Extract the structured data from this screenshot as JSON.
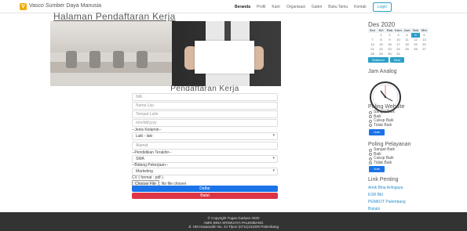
{
  "header": {
    "brand": "Vasco Sumber Daya Manusia",
    "nav": [
      "Beranda",
      "Profil",
      "Karir",
      "Organisasi",
      "Galeri",
      "Buku Tamu",
      "Kontak"
    ],
    "login_label": "Login"
  },
  "page": {
    "title": "Halaman Pendaftaran Kerja"
  },
  "form": {
    "title": "Pendaftaran Kerja",
    "nik_placeholder": "NIK",
    "nama_placeholder": "Nama Lkp",
    "tempat_placeholder": "Tempat Lahir",
    "tanggal_placeholder": "mm/dd/yyyy",
    "jenis_kelamin_label": "--Jenis Kelamin--",
    "jenis_kelamin_value": "Laki - laki",
    "alamat_placeholder": "Alamat",
    "pendidikan_label": "--Pendidikan Terakhir--",
    "pendidikan_value": "SMA",
    "bidang_label": "--Bidang Pekerjaan--",
    "bidang_value": "Marketing",
    "cv_label": "CV ( format : pdf )",
    "file_button": "Choose File",
    "file_status": "No file chosen",
    "submit_label": "Daftar",
    "reset_label": "Batal"
  },
  "calendar": {
    "title": "Des 2020",
    "days": [
      "Sen",
      "Sel",
      "Rab",
      "Kam",
      "Jum",
      "Sab",
      "Min"
    ],
    "weeks": [
      [
        "",
        "1",
        "2",
        "3",
        "4",
        "5",
        "6"
      ],
      [
        "7",
        "8",
        "9",
        "10",
        "11",
        "12",
        "13"
      ],
      [
        "14",
        "15",
        "16",
        "17",
        "18",
        "19",
        "20"
      ],
      [
        "21",
        "22",
        "23",
        "24",
        "25",
        "26",
        "27"
      ],
      [
        "28",
        "29",
        "30",
        "31",
        "",
        "",
        ""
      ]
    ],
    "today": "5",
    "prev_label": "Sebelum",
    "next_label": "Next"
  },
  "clock": {
    "title": "Jam Analog"
  },
  "poll_website": {
    "title": "Poling Website",
    "options": [
      "Sangat Baik",
      "Baik",
      "Cukup Baik",
      "Tidak Baik"
    ],
    "vote_label": "Vote"
  },
  "poll_service": {
    "title": "Poling Pelayanan",
    "options": [
      "Sangat Baik",
      "Baik",
      "Cukup Baik",
      "Tidak Baik"
    ],
    "vote_label": "Vote"
  },
  "links": {
    "title": "Link Penting",
    "items": [
      "Amik Bina Arlingaya",
      "ESR Bkt",
      "PEMKOT Palembang",
      "Bukalo"
    ]
  },
  "footer": {
    "line1": "© Copyright Tugas Gaduan 2020",
    "line2": "AMIK BINA SRIWIJAYA PALEMBANG",
    "line3": "Jl. HM Hasanudin No. 24 Tlpon (0711)311000 Palembang"
  }
}
